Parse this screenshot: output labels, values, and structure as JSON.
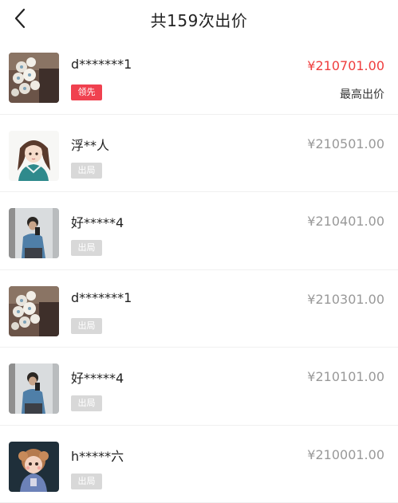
{
  "header": {
    "title": "共159次出价"
  },
  "bids": [
    {
      "name": "d*******1",
      "price": "¥210701.00",
      "badge": "领先",
      "note": "最高出价",
      "avatar": "flowers-avatar"
    },
    {
      "name": "浮**人",
      "price": "¥210501.00",
      "badge": "出局",
      "avatar": "anime-girl-avatar"
    },
    {
      "name": "好*****4",
      "price": "¥210401.00",
      "badge": "出局",
      "avatar": "mirror-selfie-avatar"
    },
    {
      "name": "d*******1",
      "price": "¥210301.00",
      "badge": "出局",
      "avatar": "flowers-avatar"
    },
    {
      "name": "好*****4",
      "price": "¥210101.00",
      "badge": "出局",
      "avatar": "mirror-selfie-avatar"
    },
    {
      "name": "h*****六",
      "price": "¥210001.00",
      "badge": "出局",
      "avatar": "doll-avatar"
    }
  ],
  "colors": {
    "lead_red": "#ef3e3e",
    "badge_out": "#d8d8d8",
    "muted_price": "#999999"
  },
  "icons": {
    "back": "chevron-left-icon"
  }
}
